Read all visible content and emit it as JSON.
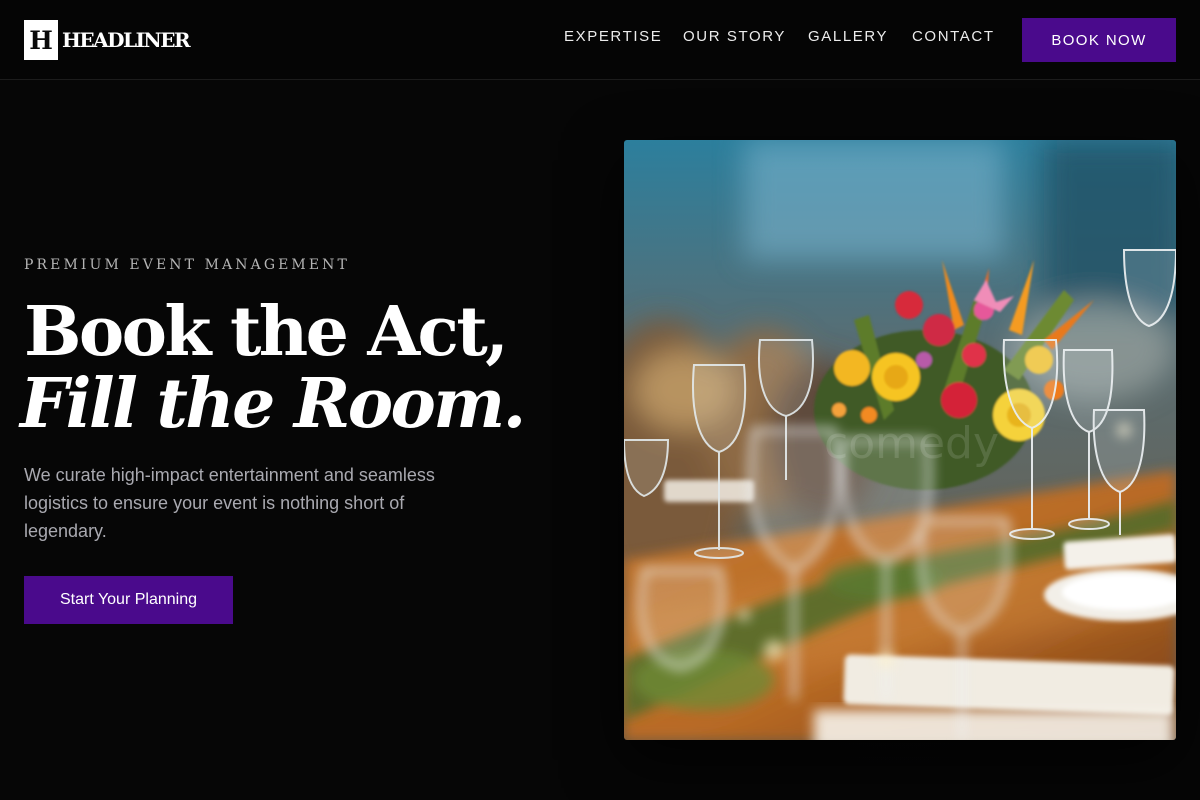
{
  "brand": {
    "mark": "H",
    "name": "HEADLINER"
  },
  "nav": {
    "items": [
      {
        "label": "EXPERTISE"
      },
      {
        "label": "OUR STORY"
      },
      {
        "label": "GALLERY"
      },
      {
        "label": "CONTACT"
      }
    ],
    "cta_label": "BOOK NOW"
  },
  "hero": {
    "eyebrow": "PREMIUM EVENT MANAGEMENT",
    "headline_line1": "Book the Act,",
    "headline_line2": "Fill the Room.",
    "description": "We curate high-impact entertainment and seamless logistics to ensure your event is nothing short of legendary.",
    "cta_label": "Start Your Planning",
    "image_subject": "banquet table with wine glasses and floral centerpiece"
  },
  "colors": {
    "background": "#060606",
    "accent": "#4a0a8c",
    "text": "#ffffff",
    "muted_text": "#a9a9b0"
  }
}
